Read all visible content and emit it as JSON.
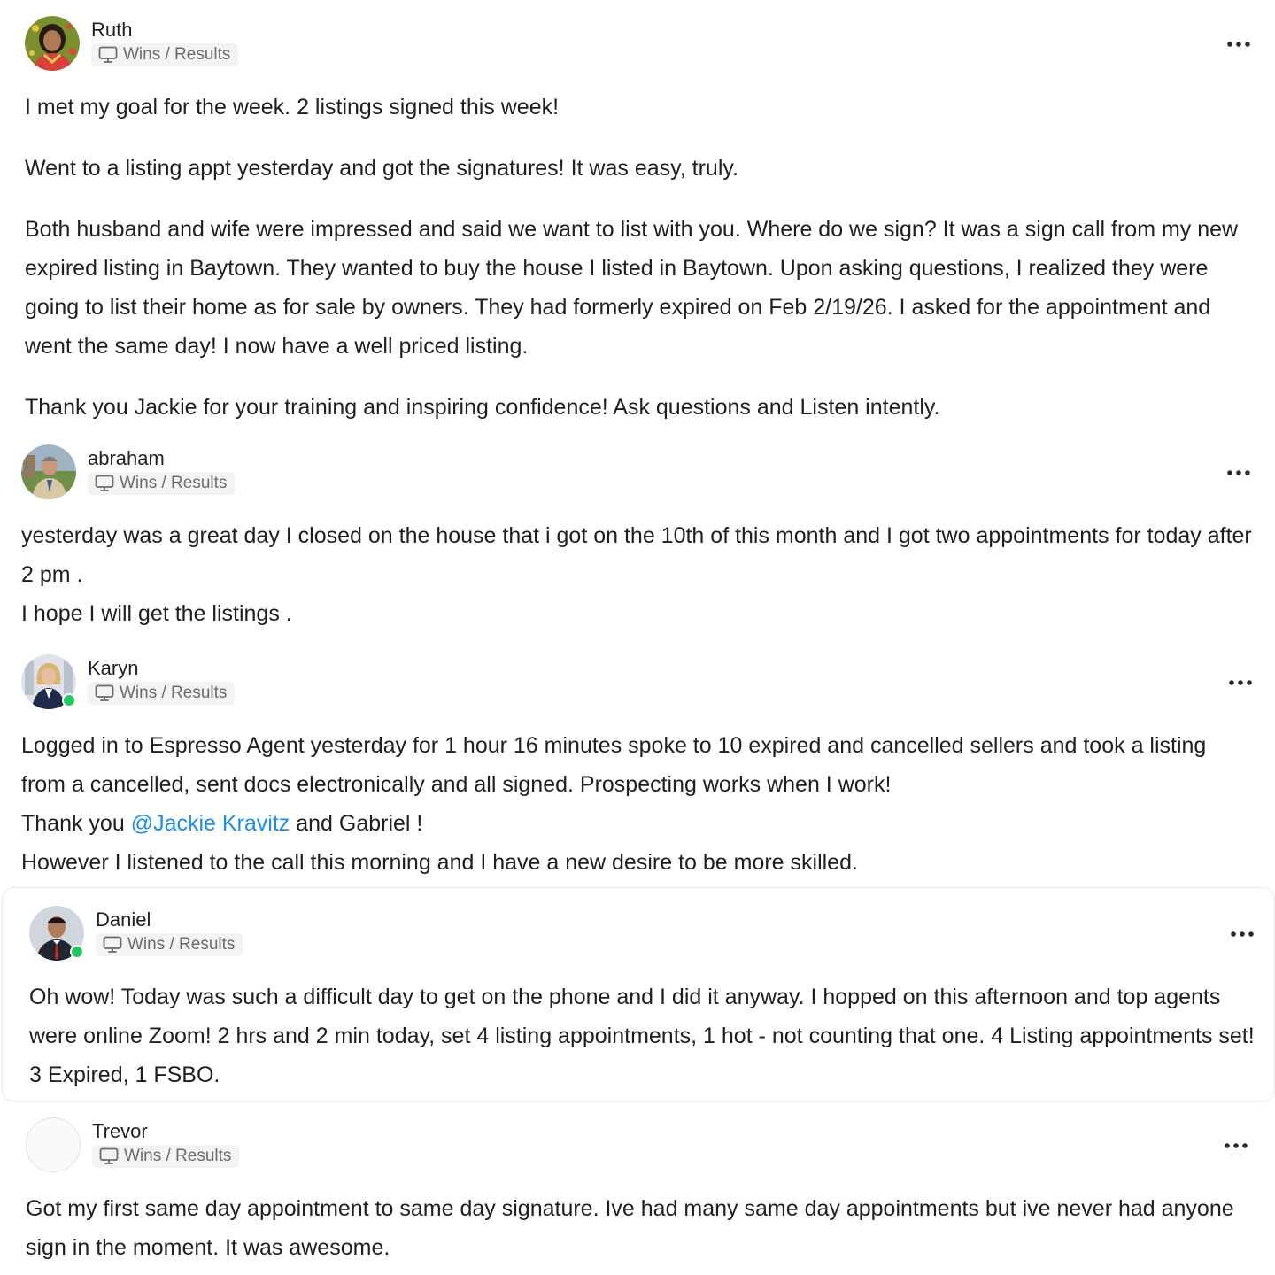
{
  "feed": {
    "posts": [
      {
        "author": "Ruth",
        "category": "Wins / Results",
        "avatar_icon": "user-photo-avatar",
        "online": false,
        "paragraphs": [
          "I met my goal for the week. 2 listings signed this week!",
          "Went to a listing appt yesterday and got the signatures! It was easy, truly.",
          "Both husband and wife were impressed and said we want to list with you. Where do we sign? It was a sign call from my new expired listing in Baytown. They wanted to buy the house I listed in Baytown. Upon asking questions, I realized they were going to list their home as for sale by owners. They had formerly expired on Feb 2/19/26. I asked for the appointment and went the same day! I now have a well priced listing.",
          "Thank you Jackie for your training and inspiring confidence! Ask questions and Listen intently."
        ]
      },
      {
        "author": "abraham",
        "category": "Wins / Results",
        "avatar_icon": "user-photo-avatar",
        "online": false,
        "lines": [
          "yesterday was a great day I closed on the house that i got on the 10th of this month and I got two appointments for today after 2 pm .",
          "I hope I will get the listings ."
        ]
      },
      {
        "author": "Karyn",
        "category": "Wins / Results",
        "avatar_icon": "user-photo-avatar",
        "online": true,
        "lines": [
          "Logged in to Espresso Agent yesterday for 1 hour 16 minutes spoke to 10 expired and cancelled sellers and took a listing from a cancelled, sent docs electronically and all signed. Prospecting works when I work!"
        ],
        "thanks_prefix": "Thank you ",
        "mention": "@Jackie Kravitz",
        "thanks_suffix": " and Gabriel !",
        "closing_line": "However I listened to the call this morning and I have a new desire to be more skilled."
      },
      {
        "author": "Daniel",
        "category": "Wins / Results",
        "avatar_icon": "user-photo-avatar",
        "online": true,
        "lines": [
          "Oh wow! Today was such a difficult day to get on the phone and I did it anyway. I hopped on this afternoon and top agents were online Zoom! 2 hrs and 2 min today, set 4 listing appointments, 1 hot - not counting that one. 4 Listing appointments set! 3 Expired, 1 FSBO."
        ]
      },
      {
        "author": "Trevor",
        "category": "Wins / Results",
        "avatar_icon": "empty-avatar",
        "online": false,
        "lines": [
          "Got my first same day appointment to same day signature. Ive had many same day appointments but ive never had anyone sign in the moment. It was awesome."
        ]
      }
    ],
    "icons": {
      "category": "monitor-icon",
      "menu": "more-dots-icon"
    },
    "colors": {
      "mention": "#1d8fe8",
      "online": "#22c55e",
      "chip_background": "#f3f3f3"
    }
  }
}
